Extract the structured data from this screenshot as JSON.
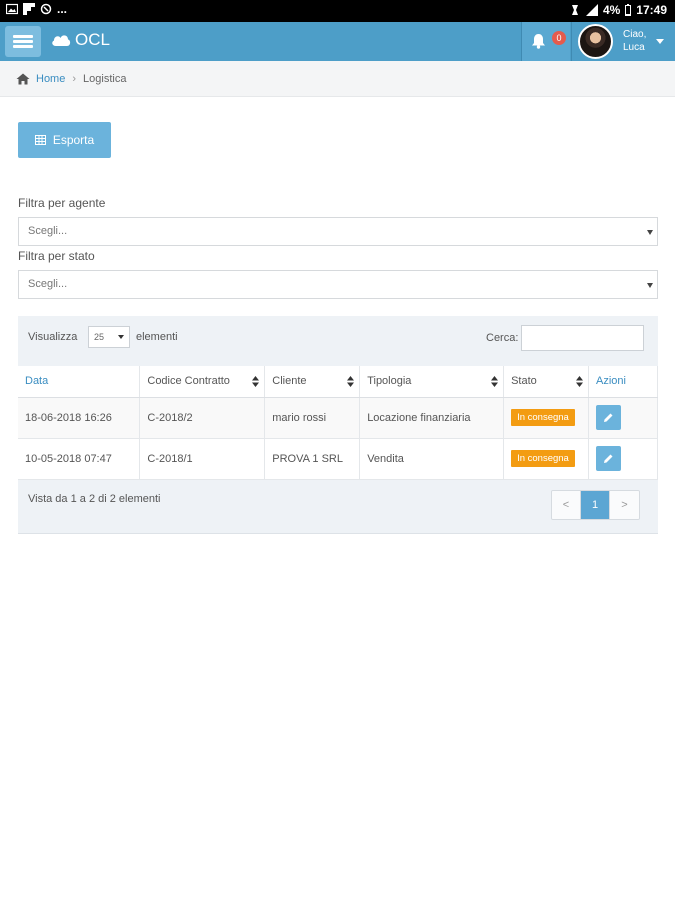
{
  "statusbar": {
    "left_extra": "...",
    "battery": "4%",
    "time": "17:49"
  },
  "header": {
    "brand": "OCL",
    "notifications_count": "0",
    "greeting": "Ciao,",
    "user_name": "Luca"
  },
  "breadcrumb": {
    "home": "Home",
    "separator": "›",
    "current": "Logistica"
  },
  "export_label": "Esporta",
  "filters": {
    "agent_label": "Filtra per agente",
    "agent_value": "Scegli...",
    "state_label": "Filtra per stato",
    "state_value": "Scegli..."
  },
  "table": {
    "length_prefix": "Visualizza",
    "length_value": "25",
    "length_suffix": "elementi",
    "search_label": "Cerca:",
    "search_value": "",
    "columns": [
      "Data",
      "Codice Contratto",
      "Cliente",
      "Tipologia",
      "Stato",
      "Azioni"
    ],
    "rows": [
      {
        "date": "18-06-2018 16:26",
        "code": "C-2018/2",
        "client": "mario rossi",
        "type": "Locazione finanziaria",
        "status": "In consegna"
      },
      {
        "date": "10-05-2018 07:47",
        "code": "C-2018/1",
        "client": "PROVA 1 SRL",
        "type": "Vendita",
        "status": "In consegna"
      }
    ],
    "info": "Vista da 1 a 2 di 2 elementi",
    "pagination": {
      "prev": "<",
      "current": "1",
      "next": ">"
    }
  },
  "colors": {
    "header": "#4d9ec8",
    "accent": "#6bb3dc",
    "status": "#f39c12",
    "badge": "#e55b4d"
  },
  "icons": [
    "image-icon",
    "flipboard-icon",
    "sync-icon",
    "alarm-icon",
    "signal-icon",
    "battery-icon",
    "menu-icon",
    "cloud-icon",
    "bell-icon",
    "home-icon",
    "grid-icon",
    "sort-icon",
    "edit-icon"
  ]
}
